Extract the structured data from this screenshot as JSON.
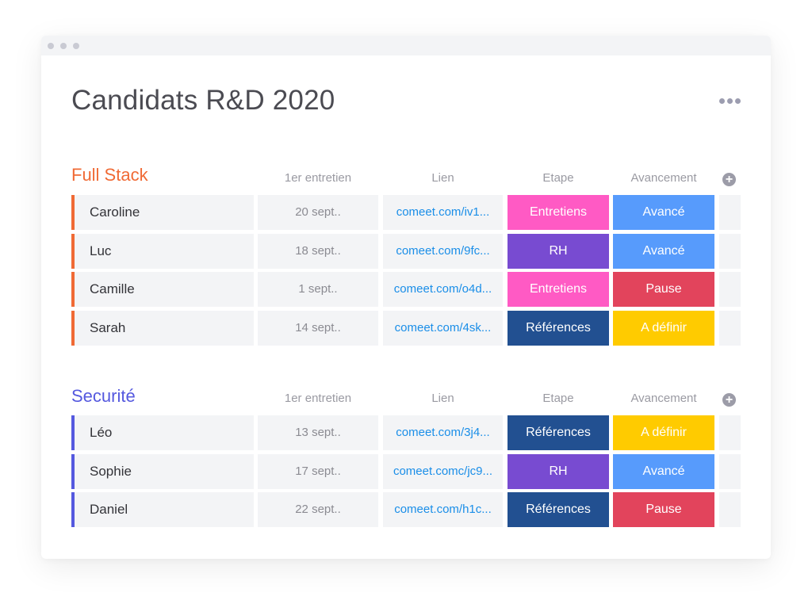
{
  "window": {
    "title": "Candidats R&D 2020",
    "more_icon": "more-horizontal-icon"
  },
  "status_colors": {
    "Entretiens": "#ff5ac4",
    "RH": "#784bd1",
    "Références": "#225091",
    "Avancé": "#579bfc",
    "Pause": "#e2445c",
    "A définir": "#ffcb00"
  },
  "columns": {
    "date": "1er entretien",
    "link": "Lien",
    "etape": "Etape",
    "avancement": "Avancement",
    "add_icon": "plus-circle-icon"
  },
  "groups": [
    {
      "title": "Full Stack",
      "color": "#f06a35",
      "rows": [
        {
          "name": "Caroline",
          "date": "20 sept..",
          "link": "comeet.com/iv1...",
          "etape": "Entretiens",
          "avancement": "Avancé"
        },
        {
          "name": "Luc",
          "date": "18 sept..",
          "link": "comeet.com/9fc...",
          "etape": "RH",
          "avancement": "Avancé"
        },
        {
          "name": "Camille",
          "date": "1 sept..",
          "link": "comeet.com/o4d...",
          "etape": "Entretiens",
          "avancement": "Pause"
        },
        {
          "name": "Sarah",
          "date": "14 sept..",
          "link": "comeet.com/4sk...",
          "etape": "Références",
          "avancement": "A définir"
        }
      ]
    },
    {
      "title": "Securité",
      "color": "#5559df",
      "rows": [
        {
          "name": "Léo",
          "date": "13 sept..",
          "link": "comeet.com/3j4...",
          "etape": "Références",
          "avancement": "A définir"
        },
        {
          "name": "Sophie",
          "date": "17 sept..",
          "link": "comeet.comc/jc9...",
          "etape": "RH",
          "avancement": "Avancé"
        },
        {
          "name": "Daniel",
          "date": "22 sept..",
          "link": "comeet.com/h1c...",
          "etape": "Références",
          "avancement": "Pause"
        }
      ]
    }
  ]
}
